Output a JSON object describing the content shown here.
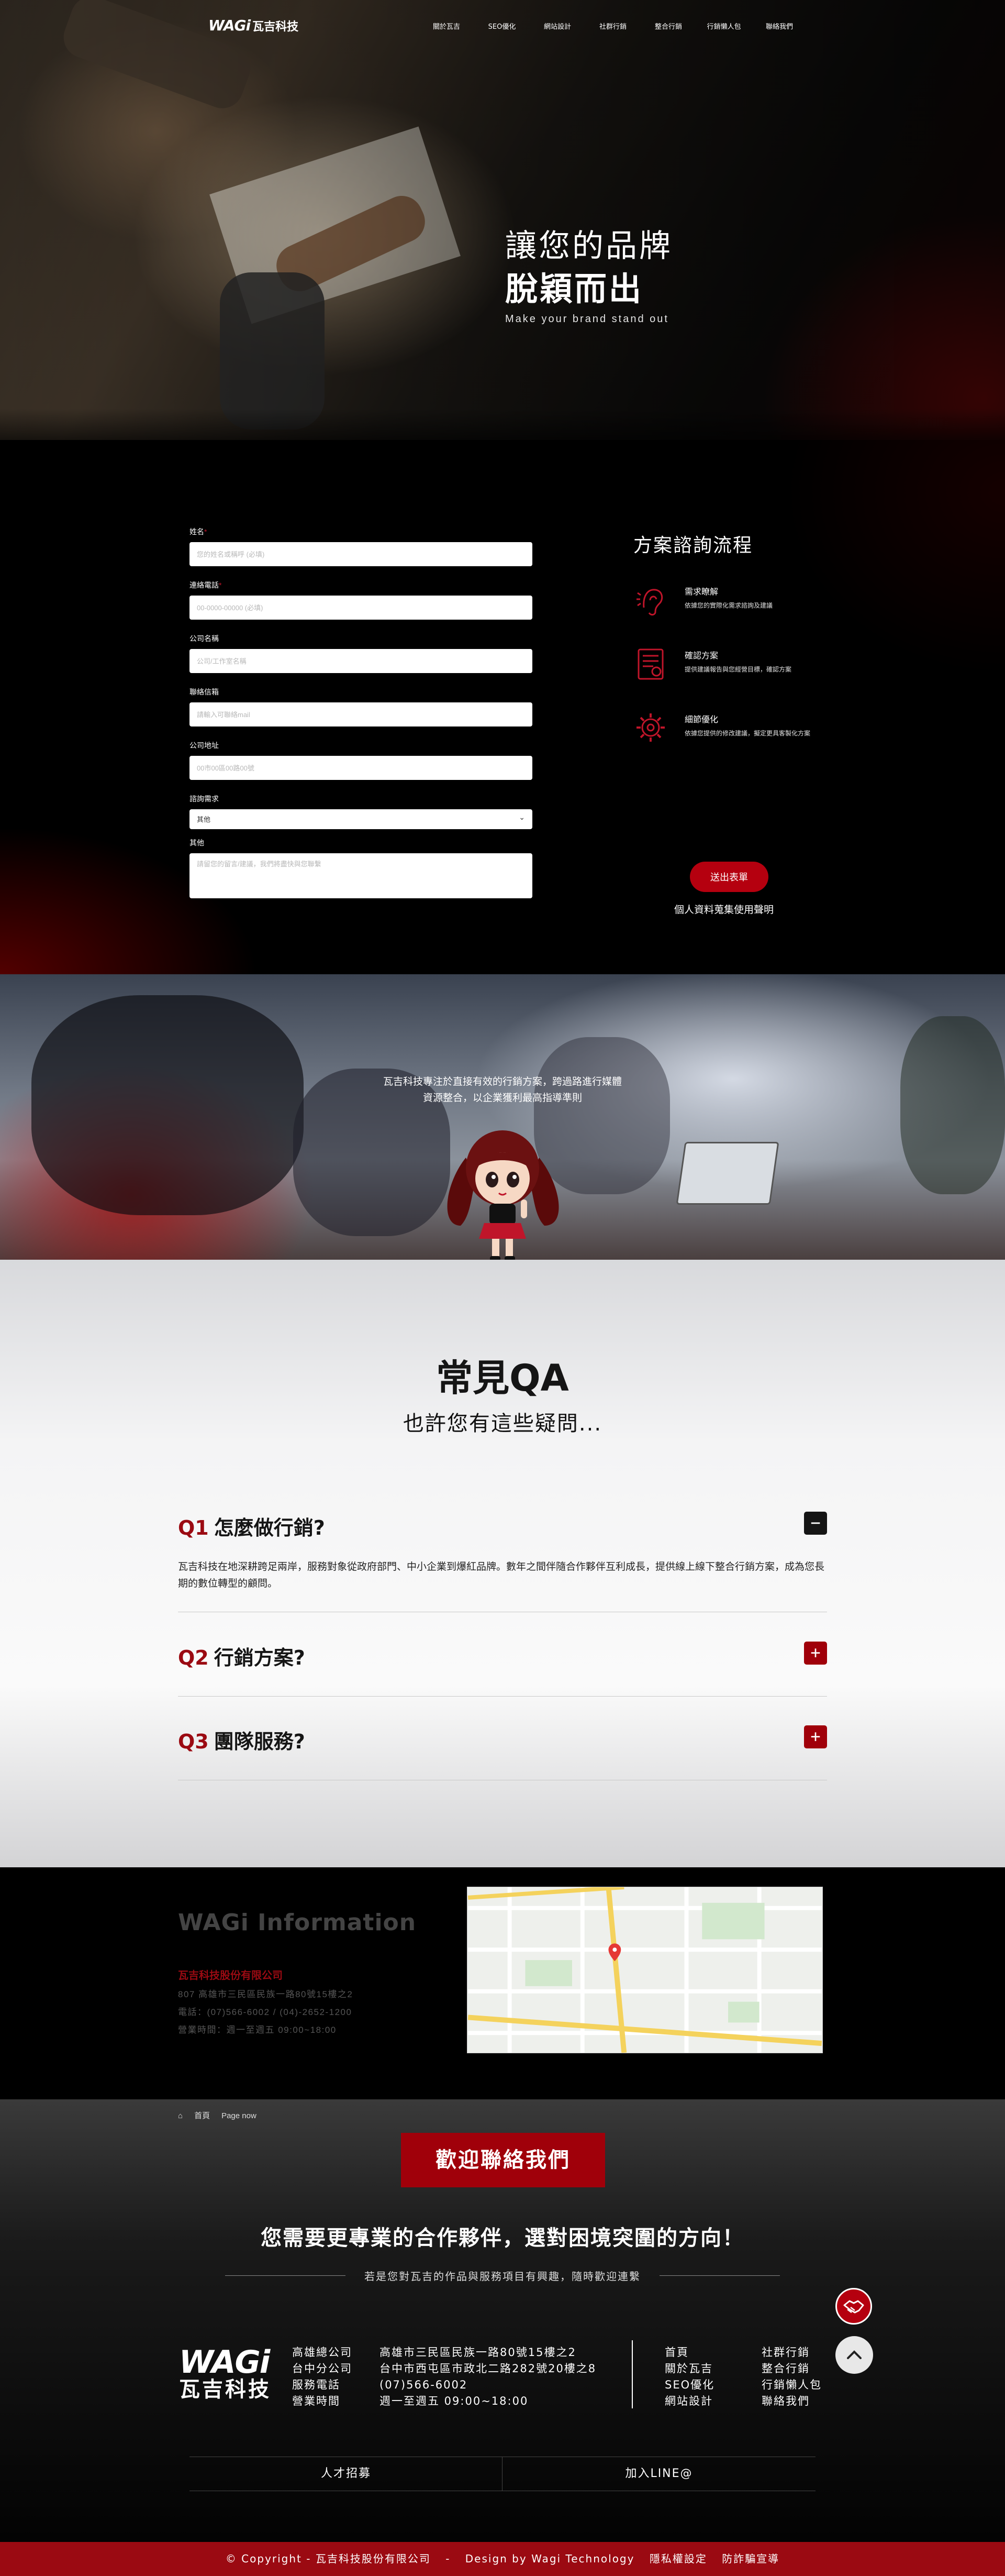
{
  "nav": {
    "logo_mark": "WAGi",
    "logo_text": "瓦吉科技",
    "items": [
      "關於瓦吉",
      "SEO優化",
      "網站設計",
      "社群行銷",
      "整合行銷",
      "行銷懶人包",
      "聯絡我們"
    ]
  },
  "hero": {
    "line1": "讓您的品牌",
    "line2": "脫穎而出",
    "line3": "Make your brand stand out"
  },
  "form": {
    "name": {
      "label": "姓名",
      "placeholder": "您的姓名或稱呼 (必填)"
    },
    "phone": {
      "label": "連絡電話",
      "placeholder": "00-0000-00000 (必填)"
    },
    "company": {
      "label": "公司名稱",
      "placeholder": "公司/工作室名稱"
    },
    "email": {
      "label": "聯絡信箱",
      "placeholder": "請輸入可聯絡mail"
    },
    "address": {
      "label": "公司地址",
      "placeholder": "00市00區00路00號"
    },
    "need": {
      "label": "諮詢需求",
      "value": "其他"
    },
    "other": {
      "label": "其他",
      "placeholder": "請留您的留言/建議，我們將盡快與您聯繫"
    },
    "required_mark": "*",
    "submit": "送出表單",
    "privacy": "個人資料蒐集使用聲明"
  },
  "process": {
    "title": "方案諮詢流程",
    "steps": [
      {
        "title": "需求瞭解",
        "desc": "依據您的實際化需求諮詢及建議",
        "icon": "ear-icon"
      },
      {
        "title": "確認方案",
        "desc": "提供建議報告與您經營目標，確認方案",
        "icon": "document-icon"
      },
      {
        "title": "細節優化",
        "desc": "依據您提供的修改建議，擬定更具客製化方案",
        "icon": "gear-icon"
      }
    ]
  },
  "office": {
    "text": "瓦吉科技專注於直接有效的行銷方案，跨過路進行媒體資源整合，以企業獲利最高指導準則"
  },
  "faq": {
    "title": "常見QA",
    "subtitle": "也許您有這些疑問...",
    "items": [
      {
        "num": "Q1",
        "q": "怎麼做行銷?",
        "toggle": "−",
        "answer": "瓦吉科技在地深耕跨足兩岸，服務對象從政府部門、中小企業到爆紅品牌。數年之間伴隨合作夥伴互利成長，提供線上線下整合行銷方案，成為您長期的數位轉型的顧問。"
      },
      {
        "num": "Q2",
        "q": "行銷方案?",
        "toggle": "+"
      },
      {
        "num": "Q3",
        "q": "團隊服務?",
        "toggle": "+"
      }
    ]
  },
  "info": {
    "title": "WAGi Information",
    "company": "瓦吉科技股份有限公司",
    "address": "807 高雄市三民區民族一路80號15樓之2",
    "phone": "電話：(07)566-6002 / (04)-2652-1200",
    "hours": "營業時間：週一至週五 09:00~18:00"
  },
  "footer": {
    "breadcrumb_home": "首頁",
    "breadcrumb_current": "Page now",
    "welcome": "歡迎聯絡我們",
    "headline": "您需要更專業的合作夥伴，選對困境突圍的方向！",
    "subline": "若是您對瓦吉的作品與服務項目有興趣，隨時歡迎連繫",
    "logo_mark": "WAGi",
    "logo_text": "瓦吉科技",
    "labels": [
      "高雄總公司",
      "台中分公司",
      "服務電話",
      "營業時間"
    ],
    "values": [
      "高雄市三民區民族一路80號15樓之2",
      "台中市西屯區市政北二路282號20樓之8",
      "(07)566-6002",
      "週一至週五 09:00~18:00"
    ],
    "links_col1": [
      "首頁",
      "關於瓦吉",
      "SEO優化",
      "網站設計"
    ],
    "links_col2": [
      "社群行銷",
      "整合行銷",
      "行銷懶人包",
      "聯絡我們"
    ],
    "btn_jobs": "人才招募",
    "btn_line": "加入LINE@",
    "copyright": "© Copyright - 瓦吉科技股份有限公司",
    "dash": "-",
    "design": "Design by Wagi Technology",
    "privacy": "隱私權設定",
    "fraud": "防詐騙宣導"
  },
  "colors": {
    "brand_red": "#9b0a12",
    "button_red": "#b5000f"
  }
}
